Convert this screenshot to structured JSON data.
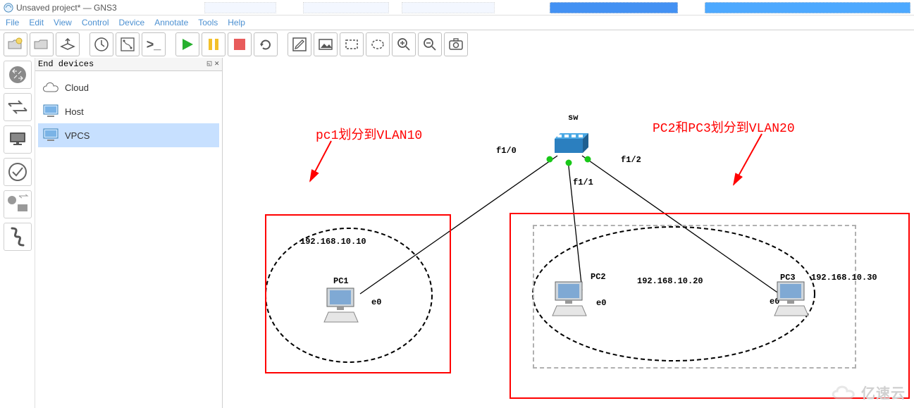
{
  "window": {
    "title": "Unsaved project* — GNS3",
    "tab_fragments": [
      "",
      "",
      "",
      ""
    ]
  },
  "menu": {
    "file": "File",
    "edit": "Edit",
    "view": "View",
    "control": "Control",
    "device": "Device",
    "annotate": "Annotate",
    "tools": "Tools",
    "help": "Help"
  },
  "panel": {
    "title": "End devices",
    "items": [
      {
        "label": "Cloud",
        "icon": "cloud"
      },
      {
        "label": "Host",
        "icon": "host"
      },
      {
        "label": "VPCS",
        "icon": "vpcs"
      }
    ]
  },
  "canvas": {
    "ann1": "pc1划分到VLAN10",
    "ann2": "PC2和PC3划分到VLAN20",
    "switch": {
      "name": "sw",
      "ports": [
        "f1/0",
        "f1/1",
        "f1/2"
      ]
    },
    "pc1": {
      "name": "PC1",
      "iface": "e0",
      "ip": "192.168.10.10"
    },
    "pc2": {
      "name": "PC2",
      "iface": "e0",
      "ip": "192.168.10.20"
    },
    "pc3": {
      "name": "PC3",
      "iface": "e0",
      "ip": "192.168.10.30"
    }
  },
  "watermark": "亿速云"
}
